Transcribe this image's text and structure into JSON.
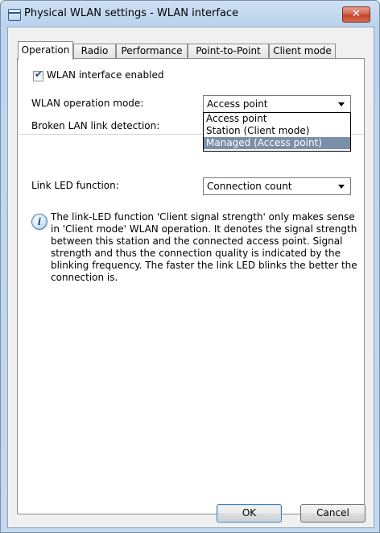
{
  "window": {
    "title": "Physical WLAN settings - WLAN interface",
    "close_label": "✕"
  },
  "tabs": [
    {
      "label": "Operation",
      "active": true
    },
    {
      "label": "Radio",
      "active": false
    },
    {
      "label": "Performance",
      "active": false
    },
    {
      "label": "Point-to-Point",
      "active": false
    },
    {
      "label": "Client mode",
      "active": false
    }
  ],
  "operation": {
    "wlan_enabled": {
      "label": "WLAN interface enabled",
      "checked": true,
      "checkmark": "✔"
    },
    "operation_mode": {
      "label": "WLAN operation mode:",
      "value": "Access point",
      "options": [
        "Access point",
        "Station (Client mode)",
        "Managed (Access point)"
      ],
      "highlighted_option": "Managed (Access point)"
    },
    "broken_lan": {
      "label": "Broken LAN link detection:"
    },
    "link_led": {
      "label": "Link LED function:",
      "value": "Connection count"
    },
    "info": {
      "icon": "info-icon",
      "icon_glyph": "i",
      "text": "The link-LED function 'Client signal strength' only makes sense in 'Client mode' WLAN operation. It denotes the signal strength between this station and the connected access point. Signal strength and thus the connection quality is indicated by the blinking frequency. The faster the link LED blinks the better the connection is."
    }
  },
  "buttons": {
    "ok": "OK",
    "cancel": "Cancel"
  },
  "colors": {
    "selection_highlight": "#7a8fa8",
    "default_button_border": "#3c7fb1"
  }
}
